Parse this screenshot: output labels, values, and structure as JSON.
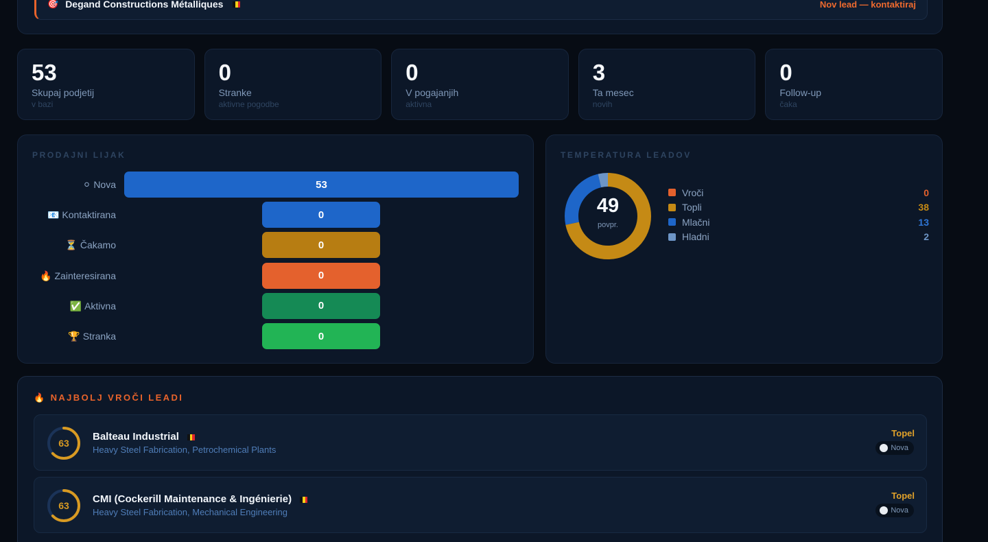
{
  "alert": {
    "icon": "🎯",
    "company": "Degand Constructions Métalliques",
    "action": "Nov lead — kontaktiraj"
  },
  "stats": [
    {
      "value": "53",
      "label": "Skupaj podjetij",
      "sub": "v bazi"
    },
    {
      "value": "0",
      "label": "Stranke",
      "sub": "aktivne pogodbe"
    },
    {
      "value": "0",
      "label": "V pogajanjih",
      "sub": "aktivna"
    },
    {
      "value": "3",
      "label": "Ta mesec",
      "sub": "novih"
    },
    {
      "value": "0",
      "label": "Follow-up",
      "sub": "čaka"
    }
  ],
  "funnel": {
    "title": "PRODAJNI LIJAK",
    "stages": [
      {
        "icon": "⚪",
        "label": "Nova",
        "value": "53",
        "color": "#1e66c9"
      },
      {
        "icon": "📧",
        "label": "Kontaktirana",
        "value": "0",
        "color": "#1e66c9"
      },
      {
        "icon": "⏳",
        "label": "Čakamo",
        "value": "0",
        "color": "#b77d12"
      },
      {
        "icon": "🔥",
        "label": "Zainteresirana",
        "value": "0",
        "color": "#e4612d"
      },
      {
        "icon": "✅",
        "label": "Aktivna",
        "value": "0",
        "color": "#158a55"
      },
      {
        "icon": "🏆",
        "label": "Stranka",
        "value": "0",
        "color": "#22b455"
      }
    ]
  },
  "temperature": {
    "title": "TEMPERATURA LEADOV",
    "average": "49",
    "average_label": "povpr.",
    "items": [
      {
        "label": "Vroči",
        "value": "0",
        "color": "#e4612d"
      },
      {
        "label": "Topli",
        "value": "38",
        "color": "#c58a15"
      },
      {
        "label": "Mlačni",
        "value": "13",
        "color": "#1e66c9"
      },
      {
        "label": "Hladni",
        "value": "2",
        "color": "#6d95c6"
      }
    ]
  },
  "hot_leads": {
    "title": "🔥 NAJBOLJ VROČI LEADI",
    "leads": [
      {
        "score": "63",
        "name": "Balteau Industrial",
        "industry": "Heavy Steel Fabrication, Petrochemical Plants",
        "temperature": "Topel",
        "status": "Nova"
      },
      {
        "score": "63",
        "name": "CMI (Cockerill Maintenance & Ingénierie)",
        "industry": "Heavy Steel Fabrication, Mechanical Engineering",
        "temperature": "Topel",
        "status": "Nova"
      }
    ]
  }
}
